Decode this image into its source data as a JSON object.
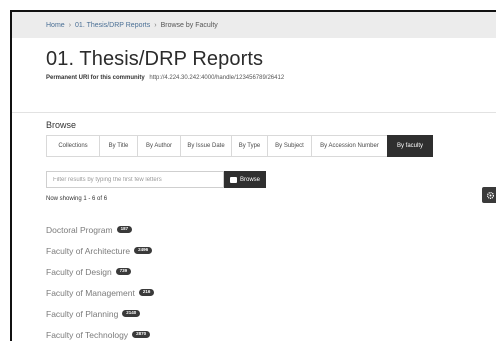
{
  "breadcrumb": [
    "Home",
    "01. Thesis/DRP Reports",
    "Browse by Faculty"
  ],
  "page_title": "01. Thesis/DRP Reports",
  "permanent_uri": {
    "label": "Permanent URI for this community",
    "value": "http://4.224.30.242:4000/handle/123456789/26412"
  },
  "browse": {
    "heading": "Browse",
    "tabs": [
      {
        "label": "Collections",
        "active": false
      },
      {
        "label": "By Title",
        "active": false
      },
      {
        "label": "By Author",
        "active": false
      },
      {
        "label": "By Issue Date",
        "active": false
      },
      {
        "label": "By Type",
        "active": false
      },
      {
        "label": "By Subject",
        "active": false
      },
      {
        "label": "By Accession Number",
        "active": false
      },
      {
        "label": "By faculty",
        "active": true
      }
    ]
  },
  "filter": {
    "placeholder": "Filter results by typing the first few letters",
    "value": "",
    "button_label": "Browse"
  },
  "showing_text": "Now showing 1 - 6 of 6",
  "faculties": [
    {
      "name": "Doctoral Program",
      "count": "187"
    },
    {
      "name": "Faculty of Architecture",
      "count": "2496"
    },
    {
      "name": "Faculty of Design",
      "count": "739"
    },
    {
      "name": "Faculty of Management",
      "count": "216"
    },
    {
      "name": "Faculty of Planning",
      "count": "2140"
    },
    {
      "name": "Faculty of Technology",
      "count": "2870"
    }
  ],
  "icons": {
    "browse_button": "browse-icon",
    "settings": "gear-icon"
  },
  "colors": {
    "active_tab": "#2f2f2f",
    "badge": "#3a3a3a",
    "topbar": "#ececec",
    "link": "#4a6f95"
  }
}
